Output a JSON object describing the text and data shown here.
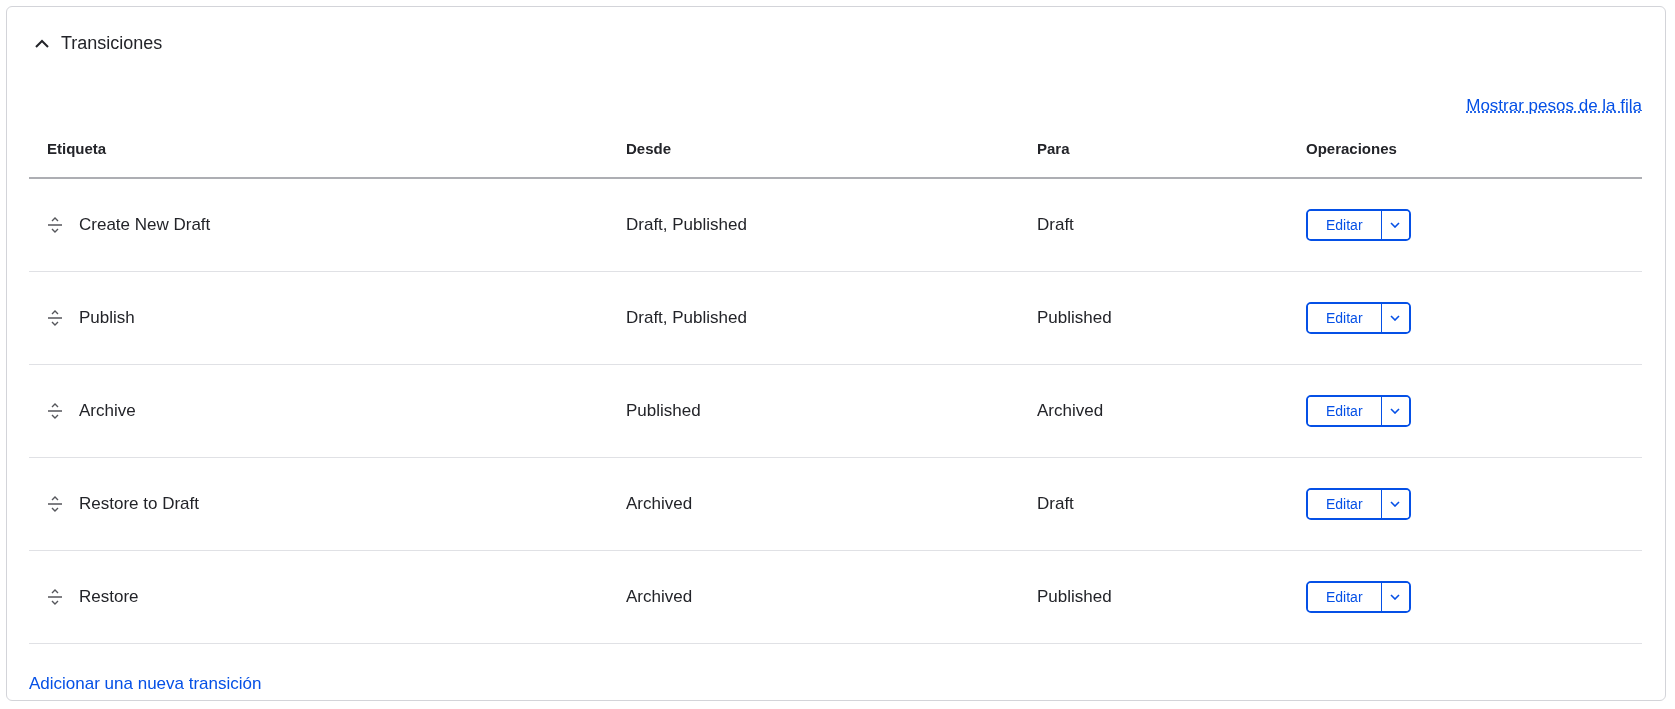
{
  "section": {
    "title": "Transiciones",
    "expanded": true
  },
  "weights_link": "Mostrar pesos de la fila",
  "table": {
    "columns": [
      "Etiqueta",
      "Desde",
      "Para",
      "Operaciones"
    ],
    "rows": [
      {
        "label": "Create New Draft",
        "from": "Draft, Published",
        "to": "Draft",
        "action": "Editar"
      },
      {
        "label": "Publish",
        "from": "Draft, Published",
        "to": "Published",
        "action": "Editar"
      },
      {
        "label": "Archive",
        "from": "Published",
        "to": "Archived",
        "action": "Editar"
      },
      {
        "label": "Restore to Draft",
        "from": "Archived",
        "to": "Draft",
        "action": "Editar"
      },
      {
        "label": "Restore",
        "from": "Archived",
        "to": "Published",
        "action": "Editar"
      }
    ]
  },
  "add_link": "Adicionar una nueva transición"
}
